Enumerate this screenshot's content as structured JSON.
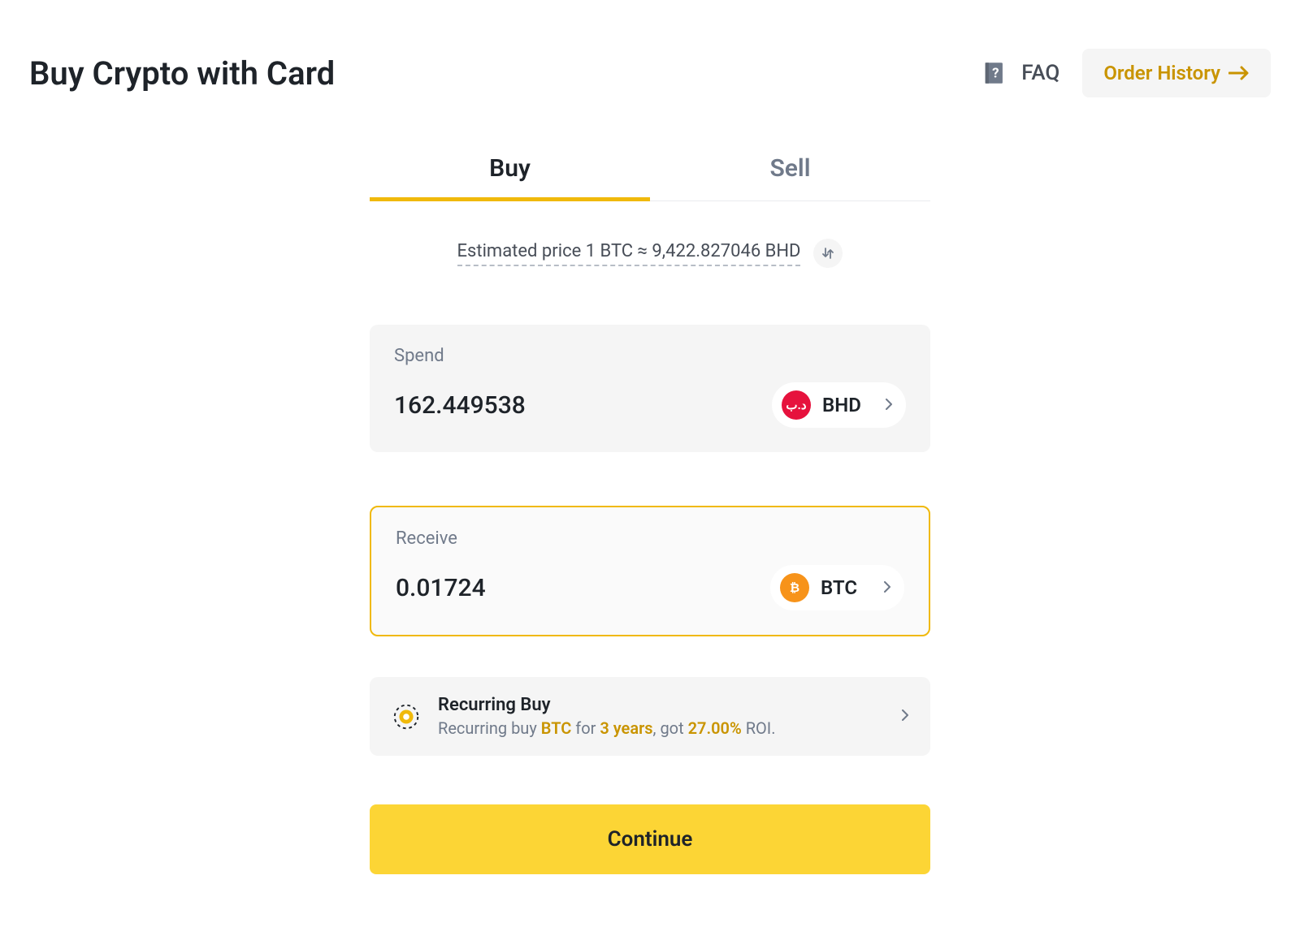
{
  "header": {
    "title": "Buy Crypto with Card",
    "faq": "FAQ",
    "order_history": "Order History"
  },
  "tabs": {
    "buy": "Buy",
    "sell": "Sell",
    "active": "buy"
  },
  "estimate": {
    "label": "Estimated price",
    "value": "1 BTC ≈ 9,422.827046 BHD"
  },
  "spend": {
    "label": "Spend",
    "amount": "162.449538",
    "currency": "BHD",
    "currency_symbol": "د.ب"
  },
  "receive": {
    "label": "Receive",
    "amount": "0.01724",
    "currency": "BTC",
    "currency_symbol": "₿"
  },
  "recurring": {
    "title": "Recurring Buy",
    "prefix": "Recurring buy ",
    "coin": "BTC",
    "mid": " for ",
    "period": "3 years",
    "mid2": ", got ",
    "roi": "27.00%",
    "suffix": " ROI."
  },
  "cta": {
    "continue": "Continue"
  }
}
